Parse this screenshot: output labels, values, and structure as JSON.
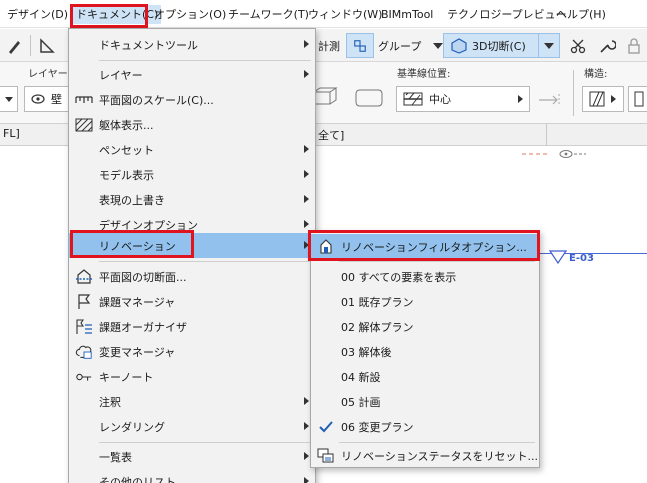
{
  "menubar": {
    "items": [
      {
        "label": "デザイン(D)"
      },
      {
        "label": "ドキュメント(C)"
      },
      {
        "label": "オプション(O)"
      },
      {
        "label": "チームワーク(T)"
      },
      {
        "label": "ウィンドウ(W)"
      },
      {
        "label": "BIMmTool"
      },
      {
        "label": "テクノロジープレビュー"
      },
      {
        "label": "ヘルプ(H)"
      }
    ]
  },
  "toolbar": {
    "measure_label": "計測",
    "group_label": "グループ",
    "section3d_label": "3D切断(C)"
  },
  "infobar": {
    "layer_label": "レイヤー:",
    "layer_value": "壁",
    "baseline_label": "基準線位置:",
    "baseline_value": "中心",
    "structure_label": "構造:"
  },
  "tabs": {
    "left_text": "FL]",
    "right_text": "全て]"
  },
  "canvas": {
    "marker_label": "E-03"
  },
  "document_menu": {
    "items": [
      {
        "label": "ドキュメントツール",
        "submenu": true
      },
      {
        "label": "レイヤー",
        "submenu": true
      },
      {
        "label": "平面図のスケール(C)...",
        "icon": "scale-icon"
      },
      {
        "label": "躯体表示...",
        "icon": "hatch-icon"
      },
      {
        "label": "ペンセット",
        "submenu": true
      },
      {
        "label": "モデル表示",
        "submenu": true
      },
      {
        "label": "表現の上書き",
        "submenu": true
      },
      {
        "label": "デザインオプション",
        "submenu": true
      },
      {
        "label": "リノベーション",
        "submenu": true,
        "highlighted": true
      },
      {
        "label": "平面図の切断面...",
        "icon": "floor-plan-cut-icon"
      },
      {
        "label": "課題マネージャ",
        "icon": "flag-icon"
      },
      {
        "label": "課題オーガナイザ",
        "icon": "issue-organizer-icon"
      },
      {
        "label": "変更マネージャ",
        "icon": "change-cloud-icon"
      },
      {
        "label": "キーノート",
        "icon": "keynote-icon"
      },
      {
        "label": "注釈",
        "submenu": true
      },
      {
        "label": "レンダリング",
        "submenu": true
      },
      {
        "label": "一覧表",
        "submenu": true
      },
      {
        "label": "その他のリスト",
        "submenu": true
      }
    ]
  },
  "renovation_submenu": {
    "items": [
      {
        "label": "リノベーションフィルタオプション...",
        "icon": "filter-options-icon",
        "highlighted": true
      },
      {
        "label": "00 すべての要素を表示"
      },
      {
        "label": "01 既存プラン"
      },
      {
        "label": "02 解体プラン"
      },
      {
        "label": "03 解体後"
      },
      {
        "label": "04 新設"
      },
      {
        "label": "05 計画"
      },
      {
        "label": "06 変更プラン",
        "checked": true
      },
      {
        "label": "リノベーションステータスをリセット...",
        "icon": "reset-status-icon"
      }
    ]
  },
  "colors": {
    "annotation_red": "#e0141e",
    "highlight_blue": "#91c1ec",
    "check_blue": "#1f5fb8"
  }
}
